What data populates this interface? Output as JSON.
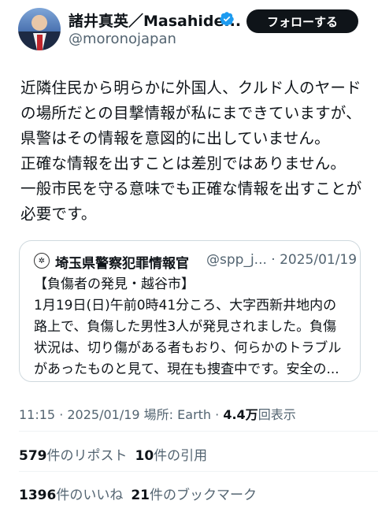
{
  "author": {
    "display_name": "諸井真英／Masahide...",
    "handle": "@moronojapan",
    "follow_label": "フォローする"
  },
  "tweet": {
    "lines": [
      "近隣住民から明らかに外国人、クルド人のヤード",
      "の場所だとの目撃情報が私にまできていますが、",
      "県警はその情報を意図的に出していません。",
      "正確な情報を出すことは差別ではありません。",
      "一般市民を守る意味でも正確な情報を出すことが",
      "必要です。"
    ]
  },
  "quote": {
    "name": "埼玉県警察犯罪情報官",
    "handle_date": "@spp_j... · 2025/01/19",
    "lines": [
      "【負傷者の発見・越谷市】",
      "1月19日(日)午前0時41分ころ、大字西新井地内の",
      "路上で、負傷した男性3人が発見されました。負傷",
      "状況は、切り傷がある者もおり、何らかのトラブル",
      "があったものと見て、現在も捜査中です。安全の..."
    ]
  },
  "meta": {
    "time_date_place": "11:15 · 2025/01/19 場所: Earth · ",
    "views_count": "4.4万",
    "views_label": "回表示"
  },
  "stats": {
    "reposts_count": "579",
    "reposts_label": "件のリポスト",
    "quotes_count": "10",
    "quotes_label": "件の引用",
    "likes_count": "1396",
    "likes_label": "件のいいね",
    "bookmarks_count": "21",
    "bookmarks_label": "件のブックマーク"
  },
  "colors": {
    "accent": "#1d9bf0",
    "text": "#0f1419",
    "secondary": "#536471"
  }
}
